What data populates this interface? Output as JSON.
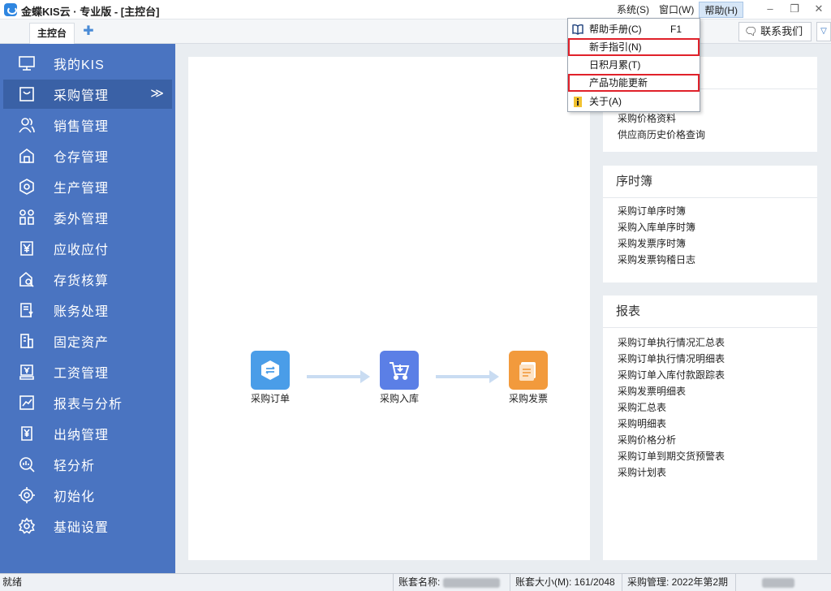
{
  "window": {
    "title": "金蝶KIS云 · 专业版 - [主控台]",
    "menus": [
      {
        "label": "系统(S)"
      },
      {
        "label": "窗口(W)"
      },
      {
        "label": "帮助(H)"
      }
    ],
    "controls": {
      "minimize": "–",
      "restore": "❐",
      "close": "✕"
    }
  },
  "tabs": {
    "active_tab": "主控台",
    "add_symbol": "✚",
    "contact_label": "联系我们",
    "expand_symbol": "▽"
  },
  "sidebar": {
    "items": [
      {
        "label": "我的KIS",
        "icon": "monitor-icon"
      },
      {
        "label": "采购管理",
        "icon": "shopping-bag-icon",
        "active": true
      },
      {
        "label": "销售管理",
        "icon": "users-icon"
      },
      {
        "label": "仓存管理",
        "icon": "warehouse-icon"
      },
      {
        "label": "生产管理",
        "icon": "hexagon-gear-icon"
      },
      {
        "label": "委外管理",
        "icon": "outsource-icon"
      },
      {
        "label": "应收应付",
        "icon": "yen-document-icon"
      },
      {
        "label": "存货核算",
        "icon": "inventory-search-icon"
      },
      {
        "label": "账务处理",
        "icon": "ledger-icon"
      },
      {
        "label": "固定资产",
        "icon": "building-icon"
      },
      {
        "label": "工资管理",
        "icon": "salary-icon"
      },
      {
        "label": "报表与分析",
        "icon": "chart-icon"
      },
      {
        "label": "出纳管理",
        "icon": "cashier-icon"
      },
      {
        "label": "轻分析",
        "icon": "analysis-icon"
      },
      {
        "label": "初始化",
        "icon": "target-icon"
      },
      {
        "label": "基础设置",
        "icon": "gear-icon"
      }
    ],
    "active_chevron": "≫"
  },
  "flow": {
    "nodes": [
      {
        "label": "采购订单",
        "icon": "purchase-order-icon",
        "color": "#4a9de8"
      },
      {
        "label": "采购入库",
        "icon": "cart-inbound-icon",
        "color": "#5b7fe6"
      },
      {
        "label": "采购发票",
        "icon": "invoice-icon",
        "color": "#f29a3c"
      }
    ]
  },
  "panels": {
    "price": {
      "links": [
        "采购价格资料",
        "供应商历史价格查询"
      ]
    },
    "sequence": {
      "title": "序时簿",
      "links": [
        "采购订单序时簿",
        "采购入库单序时簿",
        "采购发票序时簿",
        "采购发票钩稽日志"
      ]
    },
    "reports": {
      "title": "报表",
      "links": [
        "采购订单执行情况汇总表",
        "采购订单执行情况明细表",
        "采购订单入库付款跟踪表",
        "采购发票明细表",
        "采购汇总表",
        "采购明细表",
        "采购价格分析",
        "采购订单到期交货预警表",
        "采购计划表"
      ]
    }
  },
  "help_menu": {
    "items": [
      {
        "label": "帮助手册(C)",
        "shortcut": "F1",
        "icon": "book-icon",
        "highlighted": false
      },
      {
        "label": "新手指引(N)",
        "shortcut": "",
        "icon": "",
        "highlighted": true
      },
      {
        "label": "日积月累(T)",
        "shortcut": "",
        "icon": "",
        "highlighted": false
      },
      {
        "label": "产品功能更新",
        "shortcut": "",
        "icon": "",
        "highlighted": true
      },
      {
        "label": "关于(A)",
        "shortcut": "",
        "icon": "info-icon",
        "highlighted": false
      }
    ]
  },
  "status": {
    "ready": "就绪",
    "account_name_label": "账套名称:",
    "account_size": "账套大小(M): 161/2048",
    "period": "采购管理: 2022年第2期"
  },
  "colors": {
    "sidebar": "#4a74c1",
    "sidebar_active": "#3a61a6",
    "highlight_box": "#e0212a"
  }
}
